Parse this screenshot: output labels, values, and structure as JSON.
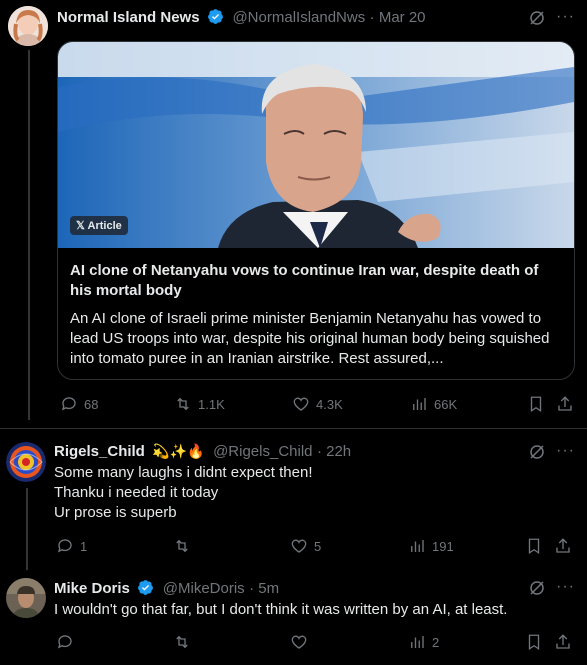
{
  "tweet1": {
    "name": "Normal Island News",
    "handle": "@NormalIslandNws",
    "time": "· Mar 20",
    "card": {
      "badge": "𝕏 Article",
      "title": "AI clone of Netanyahu vows to continue Iran war, despite death of his mortal body",
      "description": "An AI clone of Israeli prime minister Benjamin Netanyahu has vowed to lead US troops into war, despite his original human body being squished into tomato puree in an Iranian airstrike. Rest assured,..."
    },
    "replies": "68",
    "reposts": "1.1K",
    "likes": "4.3K",
    "views": "66K"
  },
  "tweet2": {
    "name": "Rigels_Child",
    "emojis": "💫✨🔥",
    "handle": "@Rigels_Child",
    "time": "· 22h",
    "lines": [
      "Some many laughs i didnt expect then!",
      "Thanku i needed it today",
      "Ur prose is superb"
    ],
    "replies": "1",
    "reposts": "",
    "likes": "5",
    "views": "191"
  },
  "tweet3": {
    "name": "Mike Doris",
    "handle": "@MikeDoris",
    "time": "· 5m",
    "text": "I wouldn't go that far, but I don't think it was written by an AI, at least.",
    "replies": "",
    "reposts": "",
    "likes": "",
    "views": "2"
  },
  "colors": {
    "accent": "#1d9bf0",
    "muted": "#71767b",
    "text": "#e7e9ea",
    "border": "#2f3336"
  }
}
